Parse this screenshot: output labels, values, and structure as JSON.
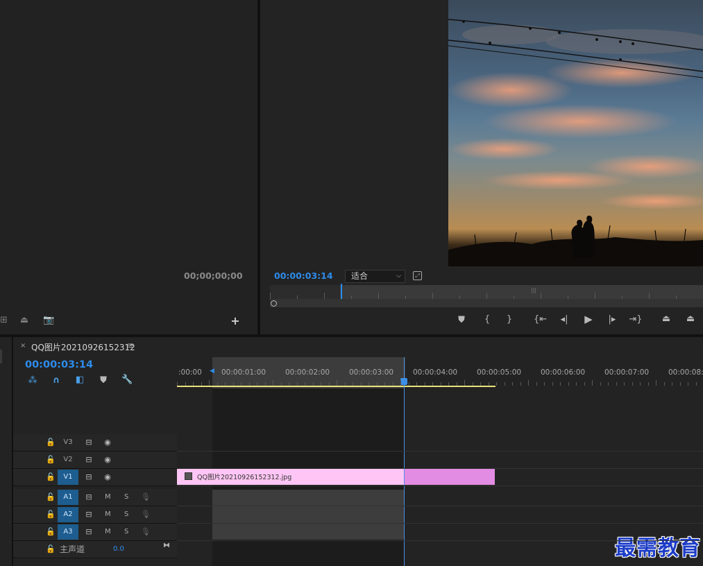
{
  "source_monitor": {
    "timecode": "00;00;00;00"
  },
  "program_monitor": {
    "timecode": "00:00:03:14",
    "zoom_select": "适合",
    "playhead_fraction": 0.163
  },
  "timeline": {
    "close_label": "×",
    "sequence_name": "QQ图片20210926152312",
    "timecode": "00:00:03:14",
    "ruler_labels": [
      ":00:00",
      "00:00:01:00",
      "00:00:02:00",
      "00:00:03:00",
      "00:00:04:00",
      "00:00:05:00",
      "00:00:06:00",
      "00:00:07:00",
      "00:00:08:0"
    ],
    "clip_name": "QQ图片20210926152312.jpg",
    "clip_color": "#ffc6f5",
    "clip_color_dark": "#e38ce3",
    "video_tracks": [
      "V3",
      "V2",
      "V1"
    ],
    "audio_tracks": [
      "A1",
      "A2",
      "A3"
    ],
    "mute_label": "M",
    "solo_label": "S",
    "master_label": "主声道",
    "master_value": "0.0"
  },
  "watermark": "最需教育"
}
